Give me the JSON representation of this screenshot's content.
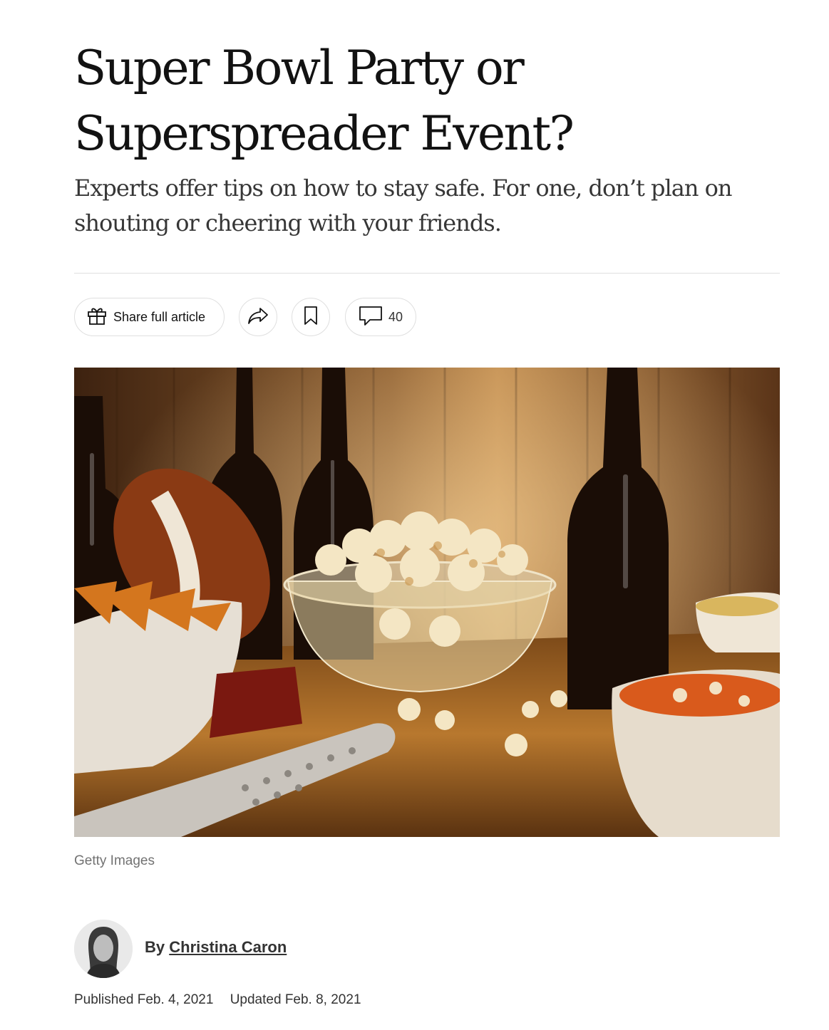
{
  "article": {
    "headline": "Super Bowl Party or Superspreader Event?",
    "summary": "Experts offer tips on how to stay safe. For one, don’t plan on shouting or cheering with your friends."
  },
  "toolbar": {
    "share_label": "Share full article",
    "share_icon": "gift-icon",
    "forward_icon": "share-arrow-icon",
    "save_icon": "bookmark-icon",
    "comments_icon": "comment-bubble-icon",
    "comments_count": "40"
  },
  "image": {
    "credit": "Getty Images"
  },
  "byline": {
    "prefix": "By",
    "author": "Christina Caron"
  },
  "dates": {
    "published": "Published Feb. 4, 2021",
    "updated": "Updated Feb. 8, 2021"
  }
}
